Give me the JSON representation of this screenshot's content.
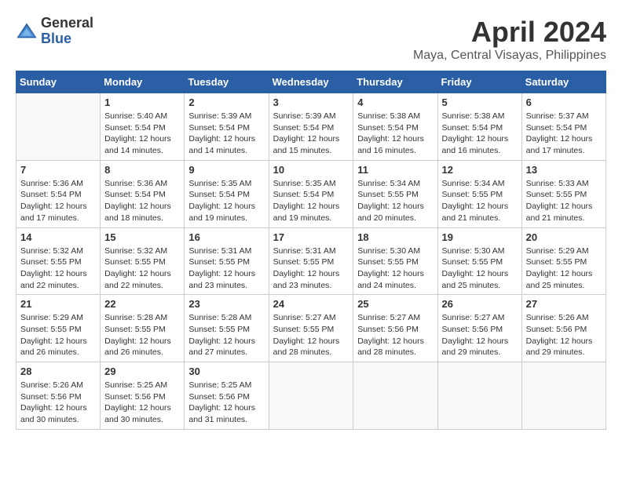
{
  "logo": {
    "general": "General",
    "blue": "Blue"
  },
  "title": {
    "month": "April 2024",
    "location": "Maya, Central Visayas, Philippines"
  },
  "headers": [
    "Sunday",
    "Monday",
    "Tuesday",
    "Wednesday",
    "Thursday",
    "Friday",
    "Saturday"
  ],
  "weeks": [
    [
      {
        "day": "",
        "info": ""
      },
      {
        "day": "1",
        "info": "Sunrise: 5:40 AM\nSunset: 5:54 PM\nDaylight: 12 hours\nand 14 minutes."
      },
      {
        "day": "2",
        "info": "Sunrise: 5:39 AM\nSunset: 5:54 PM\nDaylight: 12 hours\nand 14 minutes."
      },
      {
        "day": "3",
        "info": "Sunrise: 5:39 AM\nSunset: 5:54 PM\nDaylight: 12 hours\nand 15 minutes."
      },
      {
        "day": "4",
        "info": "Sunrise: 5:38 AM\nSunset: 5:54 PM\nDaylight: 12 hours\nand 16 minutes."
      },
      {
        "day": "5",
        "info": "Sunrise: 5:38 AM\nSunset: 5:54 PM\nDaylight: 12 hours\nand 16 minutes."
      },
      {
        "day": "6",
        "info": "Sunrise: 5:37 AM\nSunset: 5:54 PM\nDaylight: 12 hours\nand 17 minutes."
      }
    ],
    [
      {
        "day": "7",
        "info": "Sunrise: 5:36 AM\nSunset: 5:54 PM\nDaylight: 12 hours\nand 17 minutes."
      },
      {
        "day": "8",
        "info": "Sunrise: 5:36 AM\nSunset: 5:54 PM\nDaylight: 12 hours\nand 18 minutes."
      },
      {
        "day": "9",
        "info": "Sunrise: 5:35 AM\nSunset: 5:54 PM\nDaylight: 12 hours\nand 19 minutes."
      },
      {
        "day": "10",
        "info": "Sunrise: 5:35 AM\nSunset: 5:54 PM\nDaylight: 12 hours\nand 19 minutes."
      },
      {
        "day": "11",
        "info": "Sunrise: 5:34 AM\nSunset: 5:55 PM\nDaylight: 12 hours\nand 20 minutes."
      },
      {
        "day": "12",
        "info": "Sunrise: 5:34 AM\nSunset: 5:55 PM\nDaylight: 12 hours\nand 21 minutes."
      },
      {
        "day": "13",
        "info": "Sunrise: 5:33 AM\nSunset: 5:55 PM\nDaylight: 12 hours\nand 21 minutes."
      }
    ],
    [
      {
        "day": "14",
        "info": "Sunrise: 5:32 AM\nSunset: 5:55 PM\nDaylight: 12 hours\nand 22 minutes."
      },
      {
        "day": "15",
        "info": "Sunrise: 5:32 AM\nSunset: 5:55 PM\nDaylight: 12 hours\nand 22 minutes."
      },
      {
        "day": "16",
        "info": "Sunrise: 5:31 AM\nSunset: 5:55 PM\nDaylight: 12 hours\nand 23 minutes."
      },
      {
        "day": "17",
        "info": "Sunrise: 5:31 AM\nSunset: 5:55 PM\nDaylight: 12 hours\nand 23 minutes."
      },
      {
        "day": "18",
        "info": "Sunrise: 5:30 AM\nSunset: 5:55 PM\nDaylight: 12 hours\nand 24 minutes."
      },
      {
        "day": "19",
        "info": "Sunrise: 5:30 AM\nSunset: 5:55 PM\nDaylight: 12 hours\nand 25 minutes."
      },
      {
        "day": "20",
        "info": "Sunrise: 5:29 AM\nSunset: 5:55 PM\nDaylight: 12 hours\nand 25 minutes."
      }
    ],
    [
      {
        "day": "21",
        "info": "Sunrise: 5:29 AM\nSunset: 5:55 PM\nDaylight: 12 hours\nand 26 minutes."
      },
      {
        "day": "22",
        "info": "Sunrise: 5:28 AM\nSunset: 5:55 PM\nDaylight: 12 hours\nand 26 minutes."
      },
      {
        "day": "23",
        "info": "Sunrise: 5:28 AM\nSunset: 5:55 PM\nDaylight: 12 hours\nand 27 minutes."
      },
      {
        "day": "24",
        "info": "Sunrise: 5:27 AM\nSunset: 5:55 PM\nDaylight: 12 hours\nand 28 minutes."
      },
      {
        "day": "25",
        "info": "Sunrise: 5:27 AM\nSunset: 5:56 PM\nDaylight: 12 hours\nand 28 minutes."
      },
      {
        "day": "26",
        "info": "Sunrise: 5:27 AM\nSunset: 5:56 PM\nDaylight: 12 hours\nand 29 minutes."
      },
      {
        "day": "27",
        "info": "Sunrise: 5:26 AM\nSunset: 5:56 PM\nDaylight: 12 hours\nand 29 minutes."
      }
    ],
    [
      {
        "day": "28",
        "info": "Sunrise: 5:26 AM\nSunset: 5:56 PM\nDaylight: 12 hours\nand 30 minutes."
      },
      {
        "day": "29",
        "info": "Sunrise: 5:25 AM\nSunset: 5:56 PM\nDaylight: 12 hours\nand 30 minutes."
      },
      {
        "day": "30",
        "info": "Sunrise: 5:25 AM\nSunset: 5:56 PM\nDaylight: 12 hours\nand 31 minutes."
      },
      {
        "day": "",
        "info": ""
      },
      {
        "day": "",
        "info": ""
      },
      {
        "day": "",
        "info": ""
      },
      {
        "day": "",
        "info": ""
      }
    ]
  ]
}
